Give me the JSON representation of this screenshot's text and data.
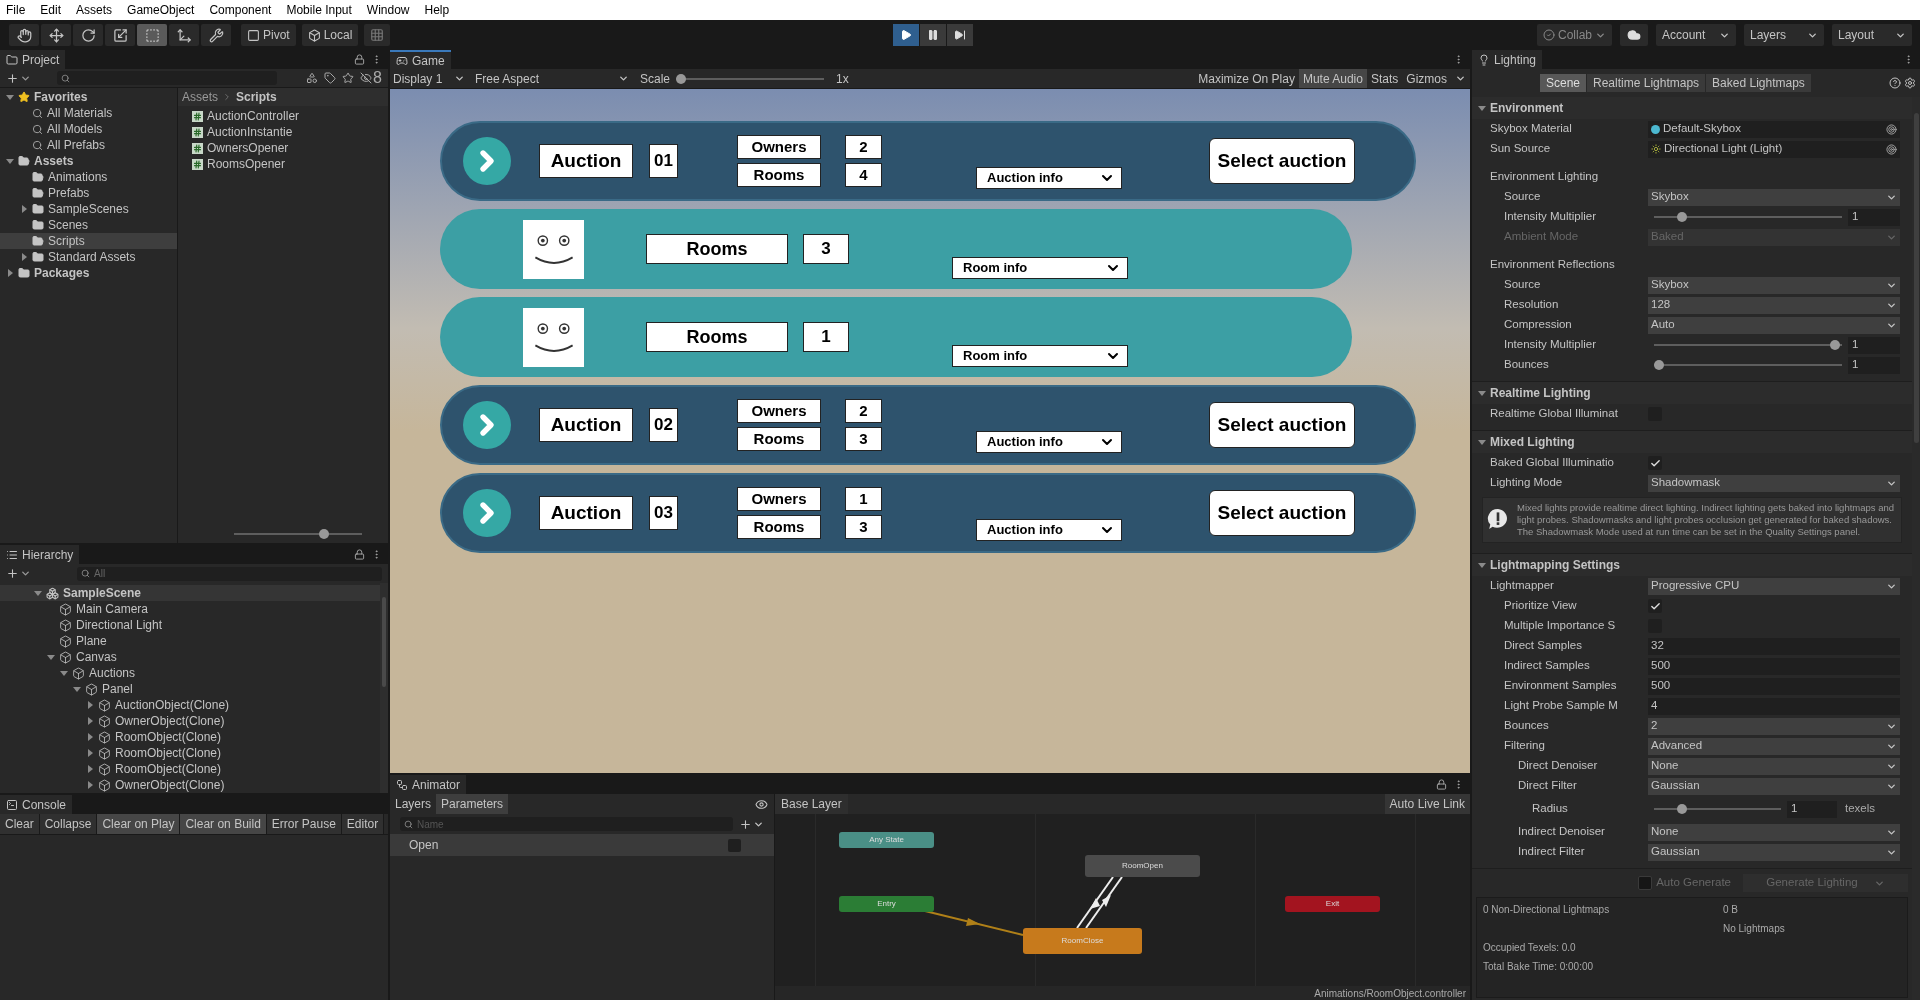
{
  "menu_bar": [
    "File",
    "Edit",
    "Assets",
    "GameObject",
    "Component",
    "Mobile Input",
    "Window",
    "Help"
  ],
  "toolbar": {
    "tools": [
      {
        "kind": "hand",
        "selected": false
      },
      {
        "kind": "move",
        "selected": false
      },
      {
        "kind": "rotate",
        "selected": false
      },
      {
        "kind": "scale",
        "selected": false
      },
      {
        "kind": "rect",
        "selected": true
      },
      {
        "kind": "transform",
        "selected": false
      },
      {
        "kind": "custom",
        "selected": false
      }
    ],
    "pivot": "Pivot",
    "local": "Local",
    "playing": true,
    "paused": false,
    "collab": "Collab",
    "account": "Account",
    "layers": "Layers",
    "layout": "Layout"
  },
  "project": {
    "title": "Project",
    "hidden_count": "8",
    "tree": [
      {
        "label": "Favorites",
        "kind": "favorites",
        "expanded": true,
        "selected": false,
        "children": [
          {
            "label": "All Materials",
            "kind": "search",
            "selected": false
          },
          {
            "label": "All Models",
            "kind": "search",
            "selected": false
          },
          {
            "label": "All Prefabs",
            "kind": "search",
            "selected": false
          }
        ]
      },
      {
        "label": "Assets",
        "kind": "open_folder",
        "expanded": true,
        "selected": false,
        "children": [
          {
            "label": "Animations",
            "kind": "open_folder",
            "selected": false
          },
          {
            "label": "Prefabs",
            "kind": "open_folder",
            "selected": false
          },
          {
            "label": "SampleScenes",
            "kind": "folder",
            "expanded": false,
            "selected": false
          },
          {
            "label": "Scenes",
            "kind": "folder",
            "selected": false
          },
          {
            "label": "Scripts",
            "kind": "open_folder",
            "selected": true
          },
          {
            "label": "Standard Assets",
            "kind": "folder",
            "expanded": false,
            "selected": false
          }
        ]
      },
      {
        "label": "Packages",
        "kind": "folder",
        "expanded": false,
        "selected": false
      }
    ],
    "breadcrumb": [
      "Assets",
      "Scripts"
    ],
    "files": [
      "AuctionController",
      "AuctionInstantie",
      "OwnersOpener",
      "RoomsOpener"
    ],
    "icon_size": {
      "level": 0.72
    }
  },
  "hierarchy": {
    "title": "Hierarchy",
    "search_placeholder": "All",
    "tree": [
      {
        "label": "SampleScene",
        "kind": "scene",
        "expanded": true,
        "children": [
          {
            "label": "Main Camera",
            "kind": "object"
          },
          {
            "label": "Directional Light",
            "kind": "object"
          },
          {
            "label": "Plane",
            "kind": "object"
          },
          {
            "label": "Canvas",
            "kind": "object",
            "expanded": true,
            "children": [
              {
                "label": "Auctions",
                "kind": "object",
                "expanded": true,
                "children": [
                  {
                    "label": "Panel",
                    "kind": "object",
                    "expanded": true,
                    "children": [
                      {
                        "label": "AuctionObject(Clone)",
                        "kind": "object",
                        "expanded": false
                      },
                      {
                        "label": "OwnerObject(Clone)",
                        "kind": "object",
                        "expanded": false
                      },
                      {
                        "label": "RoomObject(Clone)",
                        "kind": "object",
                        "expanded": false
                      },
                      {
                        "label": "RoomObject(Clone)",
                        "kind": "object",
                        "expanded": false
                      },
                      {
                        "label": "RoomObject(Clone)",
                        "kind": "object",
                        "expanded": false
                      },
                      {
                        "label": "OwnerObject(Clone)",
                        "kind": "object",
                        "expanded": false
                      }
                    ]
                  }
                ]
              }
            ]
          }
        ]
      }
    ]
  },
  "console": {
    "title": "Console",
    "buttons": [
      {
        "label": "Clear",
        "on": false
      },
      {
        "label": "Collapse",
        "on": false
      },
      {
        "label": "Clear on Play",
        "on": true
      },
      {
        "label": "Clear on Build",
        "on": true
      },
      {
        "label": "Error Pause",
        "on": false
      },
      {
        "label": "Editor",
        "on": false
      }
    ]
  },
  "game": {
    "title": "Game",
    "display": "Display 1",
    "aspect": "Free Aspect",
    "scale": {
      "label": "Scale",
      "level": 0,
      "value": "1x"
    },
    "toggles": [
      {
        "label": "Maximize On Play",
        "on": false
      },
      {
        "label": "Mute Audio",
        "on": true
      },
      {
        "label": "Stats",
        "on": false
      }
    ],
    "gizmos": "Gizmos",
    "rows": [
      {
        "kind": "auction",
        "label": "Auction",
        "number": "01",
        "owners_label": "Owners",
        "owners": "2",
        "rooms_label": "Rooms",
        "rooms": "4",
        "dropdown": "Auction info",
        "button": "Select auction"
      },
      {
        "kind": "room",
        "label": "Rooms",
        "count": "3",
        "dropdown": "Room info"
      },
      {
        "kind": "room",
        "label": "Rooms",
        "count": "1",
        "dropdown": "Room info"
      },
      {
        "kind": "auction",
        "label": "Auction",
        "number": "02",
        "owners_label": "Owners",
        "owners": "2",
        "rooms_label": "Rooms",
        "rooms": "3",
        "dropdown": "Auction info",
        "button": "Select auction"
      },
      {
        "kind": "auction",
        "label": "Auction",
        "number": "03",
        "owners_label": "Owners",
        "owners": "1",
        "rooms_label": "Rooms",
        "rooms": "3",
        "dropdown": "Auction info",
        "button": "Select auction"
      }
    ]
  },
  "animator": {
    "title": "Animator",
    "tabs": [
      {
        "label": "Layers",
        "selected": false
      },
      {
        "label": "Parameters",
        "selected": true
      }
    ],
    "search_placeholder": "Name",
    "parameters": [
      {
        "name": "Open",
        "checked": false
      }
    ],
    "breadcrumb": "Base Layer",
    "live_link": "Auto Live Link",
    "states": [
      {
        "label": "Any State",
        "kind": "any"
      },
      {
        "label": "Entry",
        "kind": "entry"
      },
      {
        "label": "RoomOpen",
        "kind": "normal"
      },
      {
        "label": "RoomClose",
        "kind": "default"
      },
      {
        "label": "Exit",
        "kind": "exit"
      }
    ],
    "path": "Animations/RoomObject.controller"
  },
  "lighting": {
    "title": "Lighting",
    "tabs": [
      {
        "label": "Scene",
        "selected": true
      },
      {
        "label": "Realtime Lightmaps",
        "selected": false
      },
      {
        "label": "Baked Lightmaps",
        "selected": false
      }
    ],
    "sections": [
      {
        "title": "Environment",
        "expanded": true,
        "rows": [
          {
            "kind": "object",
            "label": "Skybox Material",
            "value": "Default-Skybox"
          },
          {
            "kind": "object",
            "label": "Sun Source",
            "value": "Directional Light (Light)"
          },
          {
            "kind": "group",
            "label": "Environment Lighting",
            "children": [
              {
                "kind": "dropdown",
                "label": "Source",
                "value": "Skybox",
                "disabled": false
              },
              {
                "kind": "slider",
                "label": "Intensity Multiplier",
                "level": 0.13,
                "value": "1"
              },
              {
                "kind": "dropdown",
                "label": "Ambient Mode",
                "value": "Baked",
                "disabled": true
              }
            ]
          },
          {
            "kind": "group",
            "label": "Environment Reflections",
            "children": [
              {
                "kind": "dropdown",
                "label": "Source",
                "value": "Skybox",
                "disabled": false
              },
              {
                "kind": "dropdown",
                "label": "Resolution",
                "value": "128",
                "disabled": false
              },
              {
                "kind": "dropdown",
                "label": "Compression",
                "value": "Auto",
                "disabled": false
              },
              {
                "kind": "slider",
                "label": "Intensity Multiplier",
                "level": 0.99,
                "value": "1"
              },
              {
                "kind": "slider",
                "label": "Bounces",
                "level": 0,
                "value": "1"
              }
            ]
          }
        ]
      },
      {
        "title": "Realtime Lighting",
        "expanded": true,
        "rows": [
          {
            "kind": "checkbox",
            "label": "Realtime Global Illuminat",
            "checked": false
          }
        ]
      },
      {
        "title": "Mixed Lighting",
        "expanded": true,
        "rows": [
          {
            "kind": "checkbox",
            "label": "Baked Global Illuminatio",
            "checked": true
          },
          {
            "kind": "dropdown",
            "label": "Lighting Mode",
            "value": "Shadowmask",
            "disabled": false
          },
          {
            "kind": "help",
            "text": "Mixed lights provide realtime direct lighting. Indirect lighting gets baked into lightmaps and light probes. Shadowmasks and light probes occlusion get generated for baked shadows. The Shadowmask Mode used at run time can be set in the Quality Settings panel."
          }
        ]
      },
      {
        "title": "Lightmapping Settings",
        "expanded": true,
        "rows": [
          {
            "kind": "dropdown",
            "label": "Lightmapper",
            "value": "Progressive CPU",
            "disabled": false,
            "children": [
              {
                "kind": "checkbox",
                "label": "Prioritize View",
                "checked": true
              },
              {
                "kind": "checkbox",
                "label": "Multiple Importance S",
                "checked": false
              },
              {
                "kind": "number",
                "label": "Direct Samples",
                "value": "32"
              },
              {
                "kind": "number",
                "label": "Indirect Samples",
                "value": "500"
              },
              {
                "kind": "number",
                "label": "Environment Samples",
                "value": "500"
              },
              {
                "kind": "number",
                "label": "Light Probe Sample M",
                "value": "4"
              },
              {
                "kind": "dropdown",
                "label": "Bounces",
                "value": "2",
                "disabled": false
              },
              {
                "kind": "dropdown",
                "label": "Filtering",
                "value": "Advanced",
                "disabled": false,
                "children": [
                  {
                    "kind": "dropdown",
                    "label": "Direct Denoiser",
                    "value": "None",
                    "disabled": false
                  },
                  {
                    "kind": "dropdown",
                    "label": "Direct Filter",
                    "value": "Gaussian",
                    "disabled": false,
                    "children": [
                      {
                        "kind": "slider",
                        "label": "Radius",
                        "level": 0.2,
                        "value": "1",
                        "unit": "texels"
                      }
                    ]
                  },
                  {
                    "kind": "dropdown",
                    "label": "Indirect Denoiser",
                    "value": "None",
                    "disabled": false
                  },
                  {
                    "kind": "dropdown",
                    "label": "Indirect Filter",
                    "value": "Gaussian",
                    "disabled": false
                  }
                ]
              }
            ]
          }
        ]
      }
    ],
    "generate": {
      "auto_label": "Auto Generate",
      "auto_checked": false,
      "button": "Generate Lighting"
    },
    "stats": {
      "lightmaps": "0 Non-Directional Lightmaps",
      "size": "0 B",
      "status": "No Lightmaps",
      "texels": "Occupied Texels: 0.0",
      "bake_time": "Total Bake Time: 0:00:00"
    }
  }
}
